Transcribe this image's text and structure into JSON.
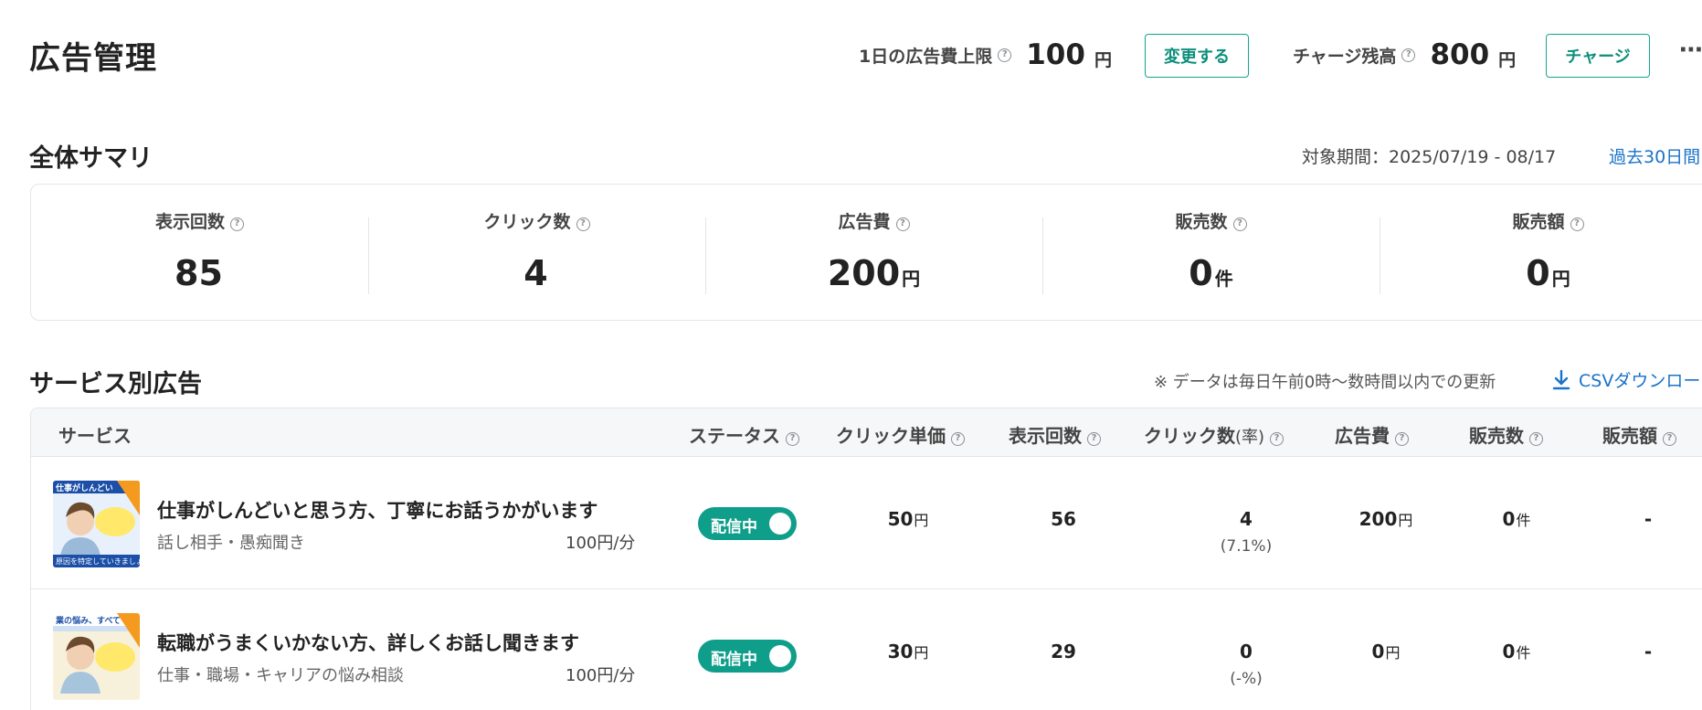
{
  "header": {
    "title": "広告管理",
    "daily_limit_label": "1日の広告費上限",
    "daily_limit_value": "100",
    "daily_limit_unit": "円",
    "change_button": "変更する",
    "balance_label": "チャージ残高",
    "balance_value": "800",
    "balance_unit": "円",
    "charge_button": "チャージ",
    "more": "⋯"
  },
  "summary": {
    "title": "全体サマリ",
    "period": "対象期間：2025/07/19 - 08/17",
    "range_link": "過去30日間",
    "metrics": [
      {
        "label": "表示回数",
        "value": "85",
        "unit": ""
      },
      {
        "label": "クリック数",
        "value": "4",
        "unit": ""
      },
      {
        "label": "広告費",
        "value": "200",
        "unit": "円"
      },
      {
        "label": "販売数",
        "value": "0",
        "unit": "件"
      },
      {
        "label": "販売額",
        "value": "0",
        "unit": "円"
      }
    ]
  },
  "service_ads": {
    "title": "サービス別広告",
    "note": "※ データは毎日午前0時〜数時間以内での更新",
    "csv_link": "CSVダウンロー",
    "columns": [
      "サービス",
      "ステータス",
      "クリック単価",
      "表示回数",
      "クリック数",
      "(率)",
      "広告費",
      "販売数",
      "販売額"
    ],
    "rows": [
      {
        "title": "仕事がしんどいと思う方、丁寧にお話うかがいます",
        "category": "話し相手・愚痴聞き",
        "price": "100円/分",
        "status": "配信中",
        "cpc": "50",
        "cpc_unit": "円",
        "impressions": "56",
        "clicks": "4",
        "click_rate": "(7.1%)",
        "cost": "200",
        "cost_unit": "円",
        "sales_count": "0",
        "sales_count_unit": "件",
        "sales_amount": "-",
        "thumb_banner": "仕事がしんどい",
        "thumb_footer": "原因を特定していきましょ"
      },
      {
        "title": "転職がうまくいかない方、詳しくお話し聞きます",
        "category": "仕事・職場・キャリアの悩み相談",
        "price": "100円/分",
        "status": "配信中",
        "cpc": "30",
        "cpc_unit": "円",
        "impressions": "29",
        "clicks": "0",
        "click_rate": "(-%)",
        "cost": "0",
        "cost_unit": "円",
        "sales_count": "0",
        "sales_count_unit": "件",
        "sales_amount": "-",
        "thumb_banner": "業の悩み、すべて",
        "thumb_footer": ""
      }
    ]
  },
  "colors": {
    "accent": "#0f9e8a",
    "link": "#1a73c8"
  }
}
